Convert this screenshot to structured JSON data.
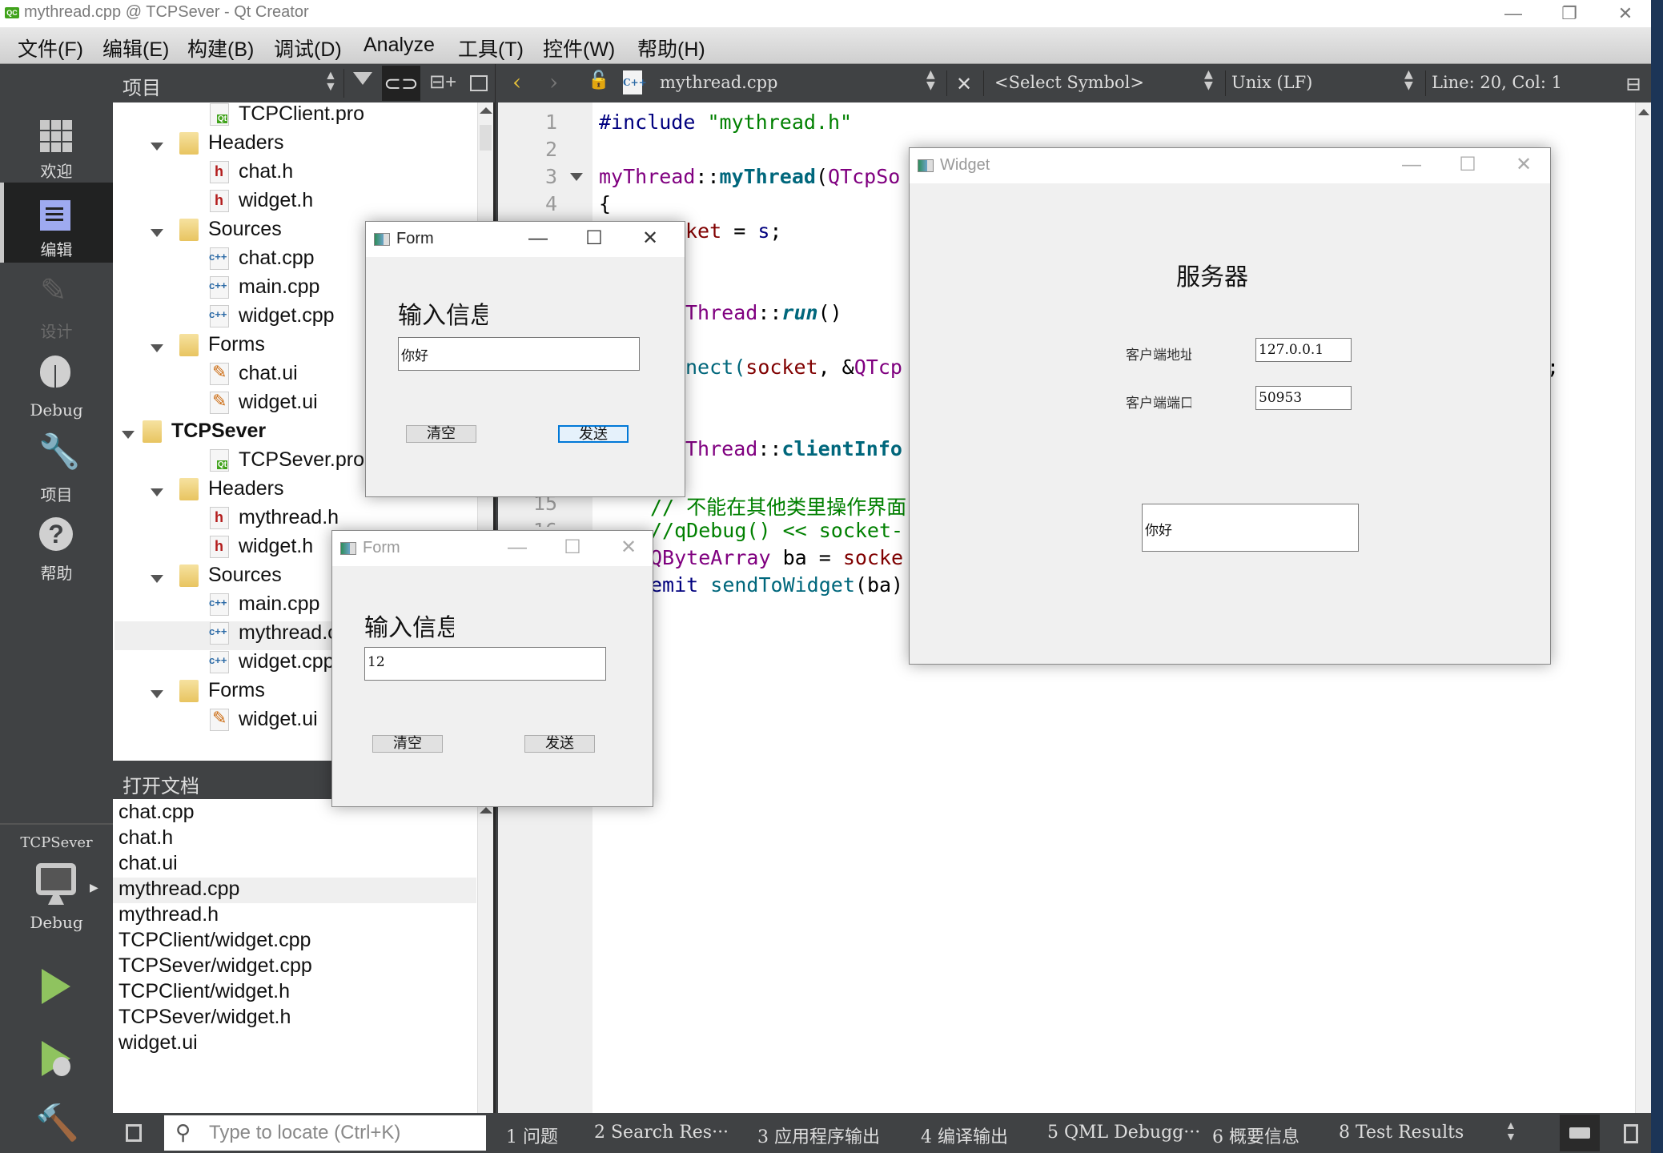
{
  "window": {
    "title": "mythread.cpp @ TCPSever - Qt Creator",
    "app_icon": "QC",
    "minimize": "—",
    "maximize": "❐",
    "close": "✕"
  },
  "menu": [
    "文件(F)",
    "编辑(E)",
    "构建(B)",
    "调试(D)",
    "Analyze",
    "工具(T)",
    "控件(W)",
    "帮助(H)"
  ],
  "modes": [
    {
      "label": "欢迎",
      "icon": "welcome-grid-icon"
    },
    {
      "label": "编辑",
      "icon": "edit-icon",
      "active": true
    },
    {
      "label": "设计",
      "icon": "design-pencil-icon",
      "disabled": true
    },
    {
      "label": "Debug",
      "icon": "debug-bug-icon"
    },
    {
      "label": "项目",
      "icon": "projects-wrench-icon"
    },
    {
      "label": "帮助",
      "icon": "help-icon"
    }
  ],
  "kit": {
    "project": "TCPSever",
    "config": "Debug"
  },
  "project_pane": {
    "title": "项目",
    "tree": [
      {
        "label": "TCPClient.pro",
        "type": "pro",
        "level": 2
      },
      {
        "label": "Headers",
        "type": "folder-h",
        "level": 1,
        "expanded": true
      },
      {
        "label": "chat.h",
        "type": "h",
        "level": 2
      },
      {
        "label": "widget.h",
        "type": "h",
        "level": 2
      },
      {
        "label": "Sources",
        "type": "folder-cpp",
        "level": 1,
        "expanded": true
      },
      {
        "label": "chat.cpp",
        "type": "cpp",
        "level": 2
      },
      {
        "label": "main.cpp",
        "type": "cpp",
        "level": 2
      },
      {
        "label": "widget.cpp",
        "type": "cpp",
        "level": 2
      },
      {
        "label": "Forms",
        "type": "folder-ui",
        "level": 1,
        "expanded": true
      },
      {
        "label": "chat.ui",
        "type": "ui",
        "level": 2
      },
      {
        "label": "widget.ui",
        "type": "ui",
        "level": 2
      },
      {
        "label": "TCPSever",
        "type": "project",
        "level": 0,
        "expanded": true
      },
      {
        "label": "TCPSever.pro",
        "type": "pro",
        "level": 2
      },
      {
        "label": "Headers",
        "type": "folder-h",
        "level": 1,
        "expanded": true
      },
      {
        "label": "mythread.h",
        "type": "h",
        "level": 2
      },
      {
        "label": "widget.h",
        "type": "h",
        "level": 2
      },
      {
        "label": "Sources",
        "type": "folder-cpp",
        "level": 1,
        "expanded": true
      },
      {
        "label": "main.cpp",
        "type": "cpp",
        "level": 2
      },
      {
        "label": "mythread.cpp",
        "type": "cpp",
        "level": 2,
        "selected": true
      },
      {
        "label": "widget.cpp",
        "type": "cpp",
        "level": 2
      },
      {
        "label": "Forms",
        "type": "folder-ui",
        "level": 1,
        "expanded": true
      },
      {
        "label": "widget.ui",
        "type": "ui",
        "level": 2
      }
    ]
  },
  "open_documents": {
    "title": "打开文档",
    "items": [
      "chat.cpp",
      "chat.h",
      "chat.ui",
      "mythread.cpp",
      "mythread.h",
      "TCPClient/widget.cpp",
      "TCPSever/widget.cpp",
      "TCPClient/widget.h",
      "TCPSever/widget.h",
      "widget.ui"
    ],
    "selected": "mythread.cpp"
  },
  "editor_toolbar": {
    "file": "mythread.cpp",
    "symbol": "<Select Symbol>",
    "line_ending": "Unix (LF)",
    "position": "Line: 20, Col: 1"
  },
  "editor": {
    "line_numbers": [
      "1",
      "2",
      "3",
      "4",
      "15",
      "16"
    ],
    "lines": {
      "l1a": "#include ",
      "l1b": "\"mythread.h\"",
      "l3a": "myThread",
      "l3b": "::",
      "l3c": "myThread",
      "l3d": "(",
      "l3e": "QTcpSo",
      "l4": "{",
      "l5a": "ket",
      "l5b": " = ",
      "l5c": "s",
      "l5d": ";",
      "l8a": "Thread",
      "l8b": "::",
      "l8c": "run",
      "l8d": "()",
      "l10a": "nect(",
      "l10b": "socket",
      "l10c": ", &",
      "l10d": "QTcp",
      "l10end": ";",
      "l13a": "Thread",
      "l13b": "::",
      "l13c": "clientInfo",
      "l15": "// 不能在其他类里操作界面",
      "l16": "//qDebug() << socket-",
      "l17a": "QByteArray",
      "l17b": " ba = ",
      "l17c": "socke",
      "l18a": "emit",
      "l18b": " sendToWidget",
      "l18c": "(ba)"
    }
  },
  "form_window_1": {
    "title": "Form",
    "label": "输入信息",
    "input_value": "你好",
    "clear_button": "清空",
    "send_button": "发送"
  },
  "form_window_2": {
    "title": "Form",
    "label": "输入信息",
    "input_value": "12",
    "clear_button": "清空",
    "send_button": "发送"
  },
  "widget_window": {
    "title": "Widget",
    "heading": "服务器",
    "client_address_label": "客户端地址",
    "client_address_value": "127.0.0.1",
    "client_port_label": "客户端端口",
    "client_port_value": "50953",
    "message_value": "你好"
  },
  "bottom_bar": {
    "locator_placeholder": "Type to locate (Ctrl+K)",
    "output_tabs": [
      "1  问题",
      "2  Search Res···",
      "3  应用程序输出",
      "4  编译输出",
      "5  QML Debugg···",
      "6  概要信息",
      "8  Test Results"
    ]
  }
}
